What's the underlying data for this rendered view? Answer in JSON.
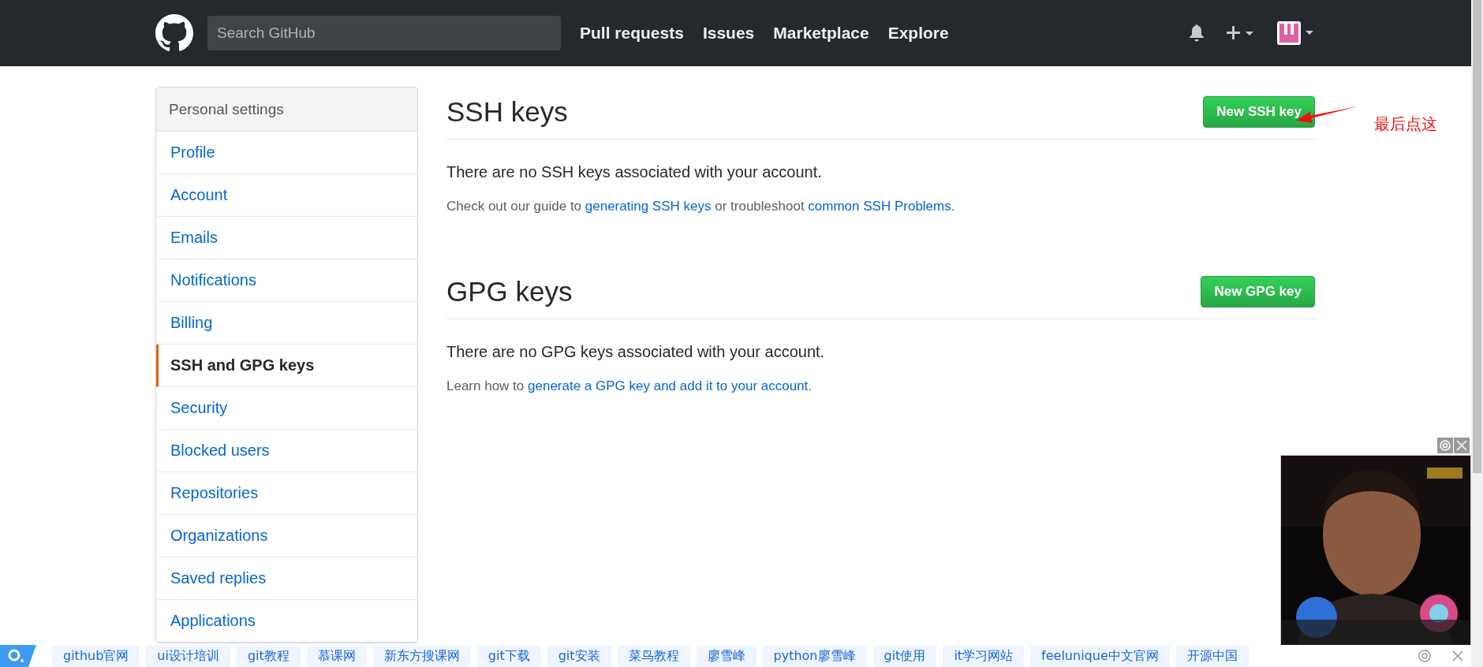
{
  "header": {
    "search": {
      "placeholder": "Search GitHub"
    },
    "nav": [
      "Pull requests",
      "Issues",
      "Marketplace",
      "Explore"
    ]
  },
  "sidebar": {
    "title": "Personal settings",
    "items": [
      {
        "label": "Profile",
        "selected": false
      },
      {
        "label": "Account",
        "selected": false
      },
      {
        "label": "Emails",
        "selected": false
      },
      {
        "label": "Notifications",
        "selected": false
      },
      {
        "label": "Billing",
        "selected": false
      },
      {
        "label": "SSH and GPG keys",
        "selected": true
      },
      {
        "label": "Security",
        "selected": false
      },
      {
        "label": "Blocked users",
        "selected": false
      },
      {
        "label": "Repositories",
        "selected": false
      },
      {
        "label": "Organizations",
        "selected": false
      },
      {
        "label": "Saved replies",
        "selected": false
      },
      {
        "label": "Applications",
        "selected": false
      }
    ]
  },
  "sections": [
    {
      "title": "SSH keys",
      "button": "New SSH key",
      "empty": "There are no SSH keys associated with your account.",
      "help": [
        {
          "text": "Check out our guide to "
        },
        {
          "link": "generating SSH keys"
        },
        {
          "text": " or troubleshoot "
        },
        {
          "link": "common SSH Problems"
        },
        {
          "text": "."
        }
      ]
    },
    {
      "title": "GPG keys",
      "button": "New GPG key",
      "empty": "There are no GPG keys associated with your account.",
      "help": [
        {
          "text": "Learn how to "
        },
        {
          "link": "generate a GPG key and add it to your account"
        },
        {
          "text": "."
        }
      ]
    }
  ],
  "annotation": {
    "text": "最后点这"
  },
  "bookmarks": [
    "github官网",
    "ui设计培训",
    "git教程",
    "慕课网",
    "新东方搜课网",
    "git下载",
    "git安装",
    "菜鸟教程",
    "廖雪峰",
    "python廖雪峰",
    "git使用",
    "it学习网站",
    "feelunique中文官网",
    "开源中国"
  ]
}
